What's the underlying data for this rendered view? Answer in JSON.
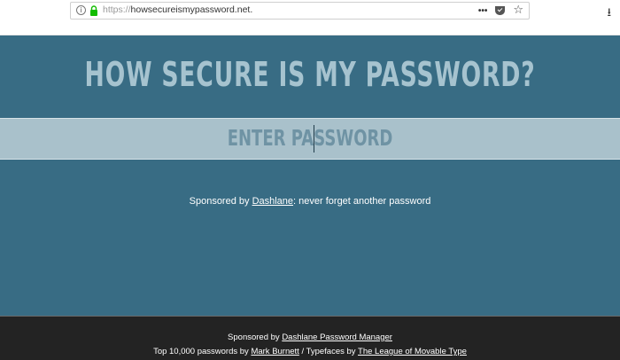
{
  "browser": {
    "url_protocol": "https://",
    "url_host": "howsecureismypassword.net.",
    "info_icon": "info-icon",
    "lock_icon": "lock-icon",
    "more_label": "•••",
    "star_label": "☆",
    "download_label": "⭳"
  },
  "main": {
    "title": "HOW SECURE IS MY PASSWORD?",
    "password_placeholder": "ENTER PASSWORD",
    "sponsor_prefix": "Sponsored by ",
    "sponsor_link": "Dashlane",
    "sponsor_suffix": ": never forget another password"
  },
  "footer": {
    "line1_prefix": "Sponsored by ",
    "line1_link": "Dashlane Password Manager",
    "line2_prefix": "Top 10,000 passwords by ",
    "line2_link1": "Mark Burnett",
    "line2_middle": " / Typefaces by ",
    "line2_link2": "The League of Movable Type"
  },
  "colors": {
    "main_bg": "#386c84",
    "title": "#a6c3cf",
    "band_bg": "#a9c1cb",
    "placeholder": "#6f93a4",
    "footer_bg": "#232323",
    "lock_green": "#12bc00"
  }
}
